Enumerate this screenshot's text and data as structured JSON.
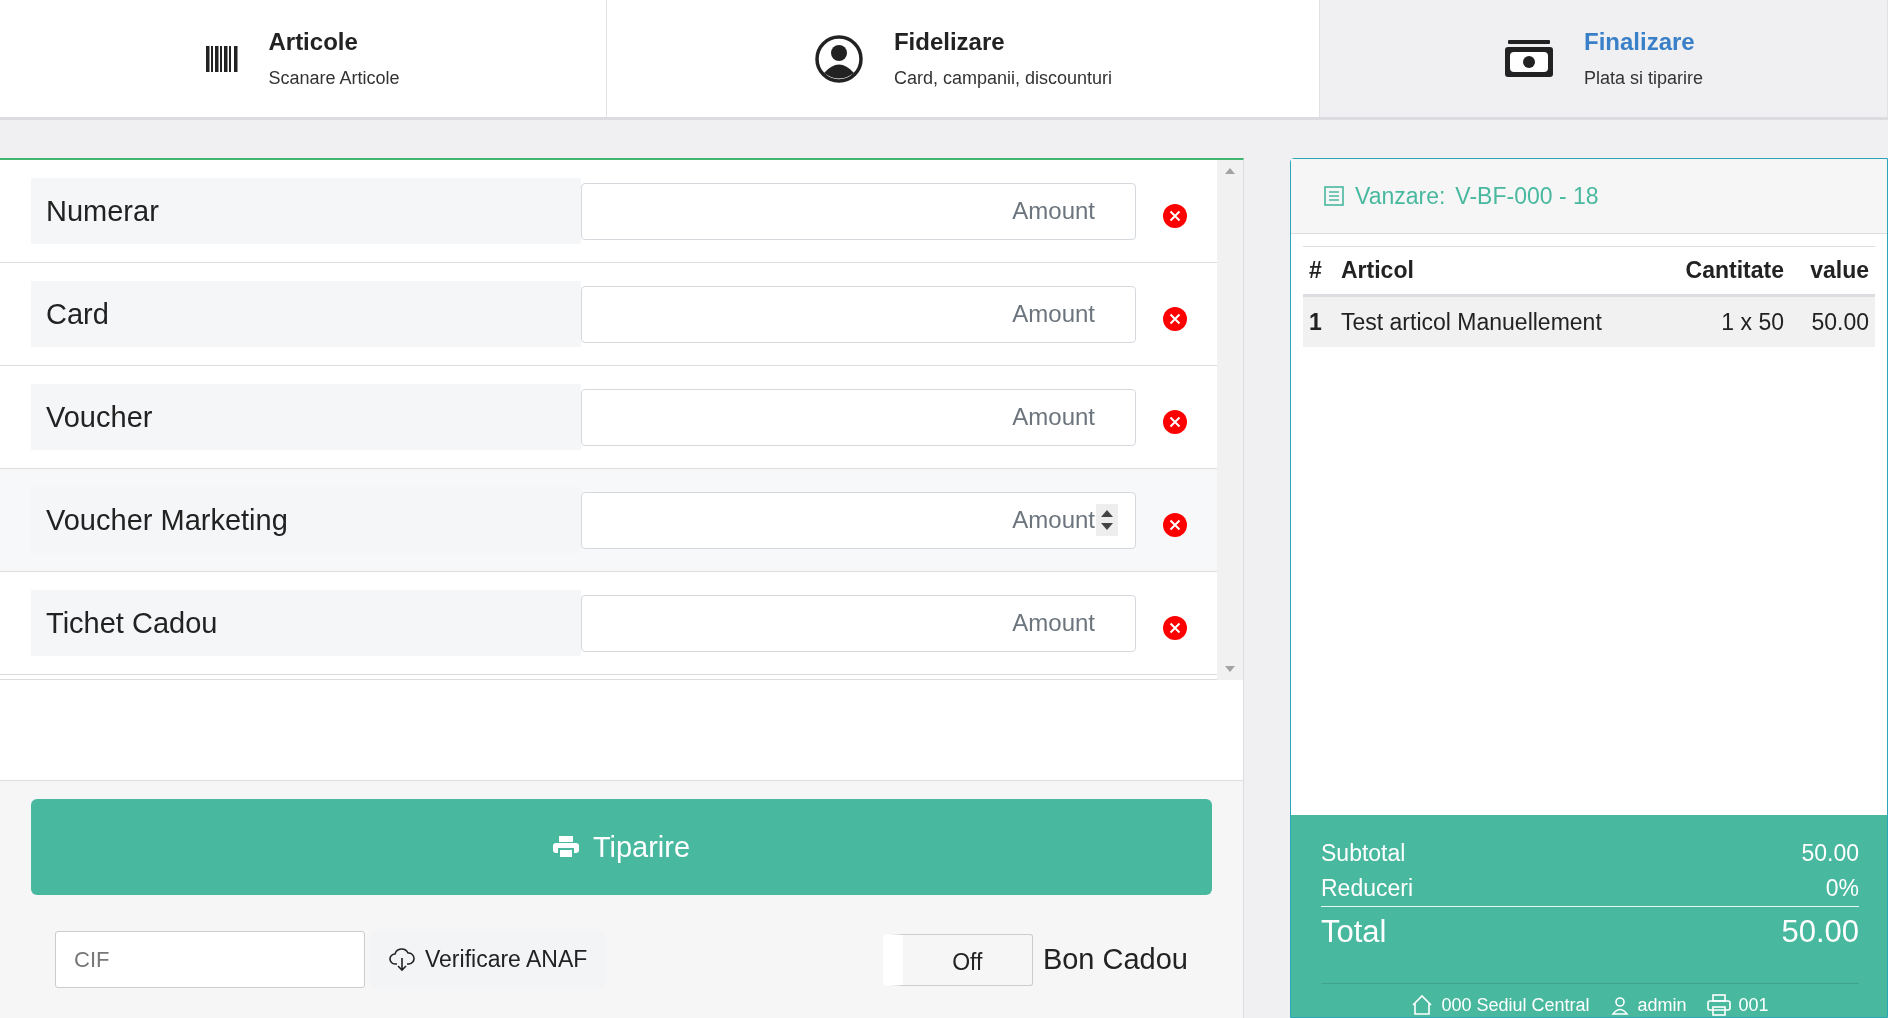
{
  "tabs": [
    {
      "title": "Articole",
      "subtitle": "Scanare Articole",
      "selected": false
    },
    {
      "title": "Fidelizare",
      "subtitle": "Card, campanii, discounturi",
      "selected": false
    },
    {
      "title": "Finalizare",
      "subtitle": "Plata si tiparire",
      "selected": true
    }
  ],
  "payment_methods": [
    {
      "label": "Numerar",
      "placeholder": "Amount",
      "hovered": false
    },
    {
      "label": "Card",
      "placeholder": "Amount",
      "hovered": false
    },
    {
      "label": "Voucher",
      "placeholder": "Amount",
      "hovered": false
    },
    {
      "label": "Voucher Marketing",
      "placeholder": "Amount",
      "hovered": true
    },
    {
      "label": "Tichet Cadou",
      "placeholder": "Amount",
      "hovered": false
    }
  ],
  "print_button": "Tiparire",
  "cif": {
    "placeholder": "CIF"
  },
  "verify_button": "Verificare ANAF",
  "gift_receipt": {
    "toggle": "Off",
    "on": false,
    "label": "Bon Cadou"
  },
  "sale": {
    "label": "Vanzare:",
    "number": "V-BF-000 - 18"
  },
  "table": {
    "columns": [
      "#",
      "Articol",
      "Cantitate",
      "value"
    ],
    "rows": [
      [
        "1",
        "Test articol Manuellement",
        "1 x 50",
        "50.00"
      ]
    ]
  },
  "totals": {
    "subtotal_label": "Subtotal",
    "subtotal": "50.00",
    "discount_label": "Reduceri",
    "discount": "0%",
    "total_label": "Total",
    "total": "50.00"
  },
  "footer": {
    "location": "000 Sediul Central",
    "user": "admin",
    "register": "001"
  }
}
